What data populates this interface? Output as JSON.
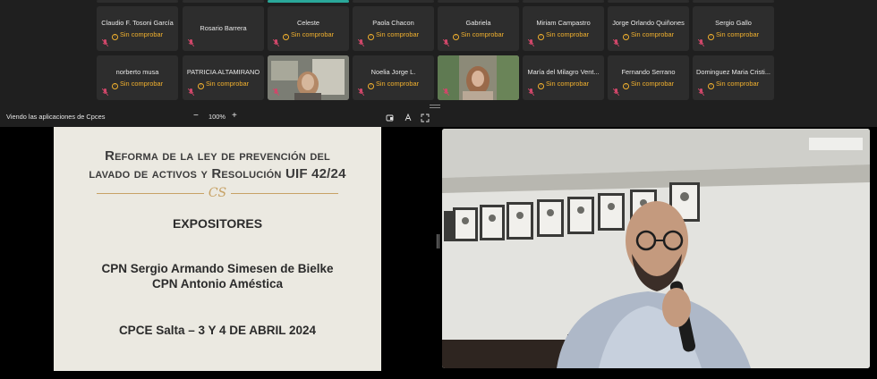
{
  "gallery": {
    "row1": [
      {
        "name": "Claudio F. Tosoni García",
        "status": "Sin comprobar"
      },
      {
        "name": "Rosario Barrera",
        "status": ""
      },
      {
        "name": "Celeste",
        "status": "Sin comprobar"
      },
      {
        "name": "Paola Chacon",
        "status": "Sin comprobar"
      },
      {
        "name": "Gabriela",
        "status": "Sin comprobar"
      },
      {
        "name": "Miriam Campastro",
        "status": "Sin comprobar"
      },
      {
        "name": "Jorge Orlando Quiñones",
        "status": "Sin comprobar"
      },
      {
        "name": "Sergio Gallo",
        "status": "Sin comprobar"
      }
    ],
    "row2": [
      {
        "name": "norberto musa",
        "status": "Sin comprobar",
        "video": false
      },
      {
        "name": "PATRICIA ALTAMIRANO",
        "status": "Sin comprobar",
        "video": false
      },
      {
        "name": "",
        "status": "",
        "video": true
      },
      {
        "name": "Noelia Jorge L.",
        "status": "Sin comprobar",
        "video": false
      },
      {
        "name": "",
        "status": "",
        "video": true
      },
      {
        "name": "María del Milagro Vent...",
        "status": "Sin comprobar",
        "video": false
      },
      {
        "name": "Fernando Serrano",
        "status": "Sin comprobar",
        "video": false
      },
      {
        "name": "Dominguez Maria Cristi...",
        "status": "Sin comprobar",
        "video": false
      }
    ]
  },
  "toolbar": {
    "title": "Viendo las aplicaciones de Cpces",
    "zoom_minus": "−",
    "zoom_value": "100%",
    "zoom_plus": "+"
  },
  "slide": {
    "title_line1": "Reforma de la ley de prevención del",
    "title_line2": "lavado de activos y Resolución UIF 42/24",
    "ornament": "CS",
    "heading": "EXPOSITORES",
    "speaker1": "CPN Sergio Armando Simesen de Bielke",
    "speaker2": "CPN Antonio Améstica",
    "footer": "CPCE Salta – 3 Y 4 DE ABRIL 2024"
  },
  "colors": {
    "tile_bg": "#2d2d2d",
    "status": "#f2b12e",
    "muted_mic": "#d2476a",
    "active_speaker": "#2aa89a",
    "slide_bg": "#ebe9e1"
  }
}
